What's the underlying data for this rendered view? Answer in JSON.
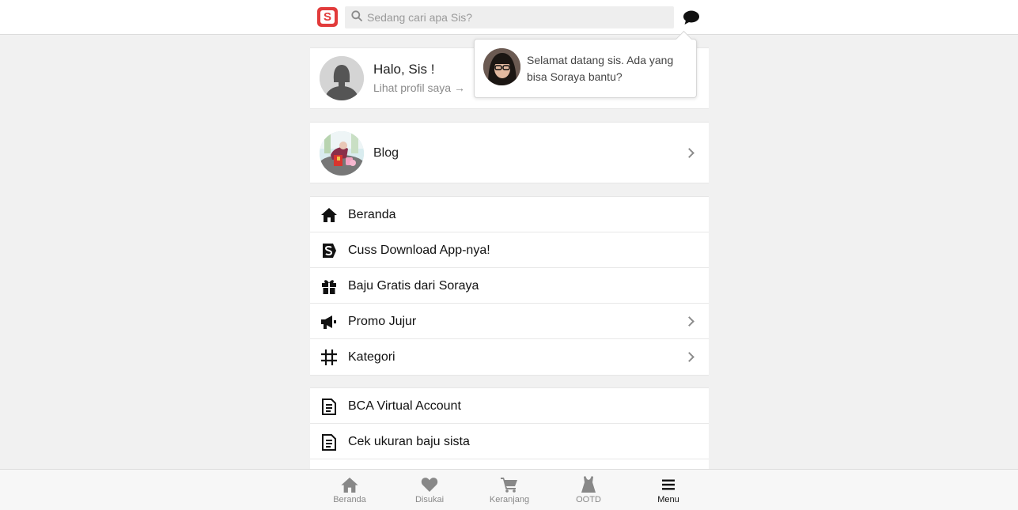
{
  "header": {
    "logo_letter": "S",
    "search_placeholder": "Sedang cari apa Sis?",
    "search_value": "",
    "icons": [
      "search-icon",
      "chat-icon"
    ]
  },
  "profile": {
    "greeting": "Halo, Sis !",
    "link_label": "Lihat profil saya →"
  },
  "tooltip": {
    "message": "Selamat datang sis. Ada yang bisa Soraya bantu?"
  },
  "blog": {
    "label": "Blog"
  },
  "menu_primary": [
    {
      "label": "Beranda",
      "icon": "home-icon",
      "chevron": false
    },
    {
      "label": "Cuss Download App-nya!",
      "icon": "soraya-app-icon",
      "chevron": false
    },
    {
      "label": "Baju Gratis dari Soraya",
      "icon": "gift-icon",
      "chevron": false
    },
    {
      "label": "Promo Jujur",
      "icon": "megaphone-icon",
      "chevron": true
    },
    {
      "label": "Kategori",
      "icon": "hashtag-icon",
      "chevron": true
    }
  ],
  "menu_secondary": [
    {
      "label": "BCA Virtual Account",
      "icon": "document-icon"
    },
    {
      "label": "Cek ukuran baju sista",
      "icon": "document-icon"
    }
  ],
  "bottom_nav": [
    {
      "label": "Beranda",
      "icon": "home-icon",
      "active": false
    },
    {
      "label": "Disukai",
      "icon": "heart-icon",
      "active": false
    },
    {
      "label": "Keranjang",
      "icon": "cart-icon",
      "active": false
    },
    {
      "label": "OOTD",
      "icon": "dress-icon",
      "active": false
    },
    {
      "label": "Menu",
      "icon": "hamburger-icon",
      "active": true
    }
  ],
  "colors": {
    "brand": "#e23b3b",
    "background": "#f1f1f1",
    "muted_text": "#8a8a8a"
  }
}
